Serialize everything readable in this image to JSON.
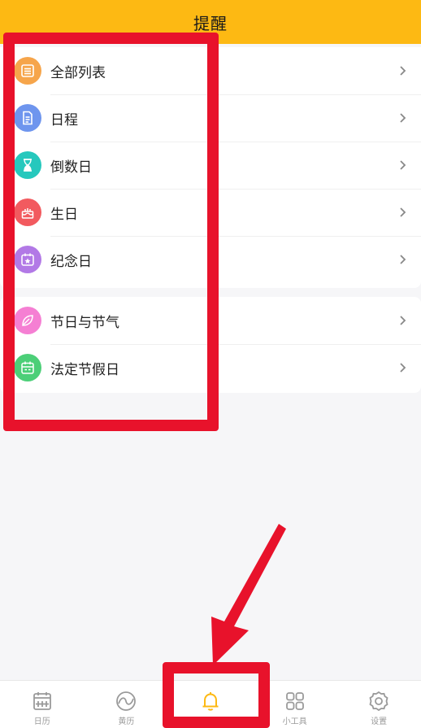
{
  "header": {
    "title": "提醒"
  },
  "list_group_1": [
    {
      "label": "全部列表",
      "icon": "list-icon",
      "color": "#f6a54b"
    },
    {
      "label": "日程",
      "icon": "document-icon",
      "color": "#6e95ee"
    },
    {
      "label": "倒数日",
      "icon": "hourglass-icon",
      "color": "#26c8bd"
    },
    {
      "label": "生日",
      "icon": "cake-icon",
      "color": "#f25a5f"
    },
    {
      "label": "纪念日",
      "icon": "calendar-star-icon",
      "color": "#b279e6"
    }
  ],
  "list_group_2": [
    {
      "label": "节日与节气",
      "icon": "leaf-icon",
      "color": "#f57fd3"
    },
    {
      "label": "法定节假日",
      "icon": "holiday-calendar-icon",
      "color": "#4ccf78"
    }
  ],
  "tabbar": {
    "items": [
      {
        "label": "日历",
        "icon": "calendar-icon"
      },
      {
        "label": "黄历",
        "icon": "yinyang-icon"
      },
      {
        "label": "提醒",
        "icon": "bell-icon",
        "active": true
      },
      {
        "label": "小工具",
        "icon": "grid-icon"
      },
      {
        "label": "设置",
        "icon": "gear-icon"
      }
    ]
  },
  "colors": {
    "accent": "#fdb913",
    "annotation": "#e8122b"
  }
}
